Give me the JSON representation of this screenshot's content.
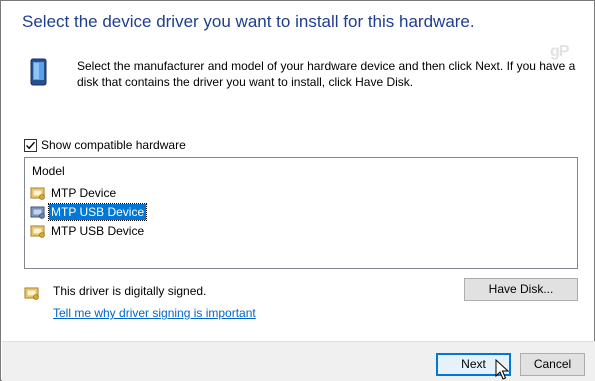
{
  "header": {
    "title": "Select the device driver you want to install for this hardware.",
    "description_line1": "Select the manufacturer and model of your hardware device and then click Next. If you have a",
    "description_line2": "disk that contains the driver you want to install, click Have Disk.",
    "watermark": "gP",
    "icon": "device-icon"
  },
  "compatible": {
    "label": "Show compatible hardware",
    "checked": true
  },
  "model_list": {
    "header": "Model",
    "items": [
      {
        "label": "MTP Device",
        "selected": false,
        "icon": "driver-icon"
      },
      {
        "label": "MTP USB Device",
        "selected": true,
        "icon": "driver-icon"
      },
      {
        "label": "MTP USB Device",
        "selected": false,
        "icon": "driver-icon"
      }
    ]
  },
  "signing": {
    "status": "This driver is digitally signed.",
    "link": "Tell me why driver signing is important",
    "icon": "certificate-icon"
  },
  "buttons": {
    "have_disk": "Have Disk...",
    "next": "Next",
    "cancel": "Cancel"
  },
  "colors": {
    "title": "#1f3f8a",
    "selection": "#0078d7",
    "link": "#0066cc"
  }
}
